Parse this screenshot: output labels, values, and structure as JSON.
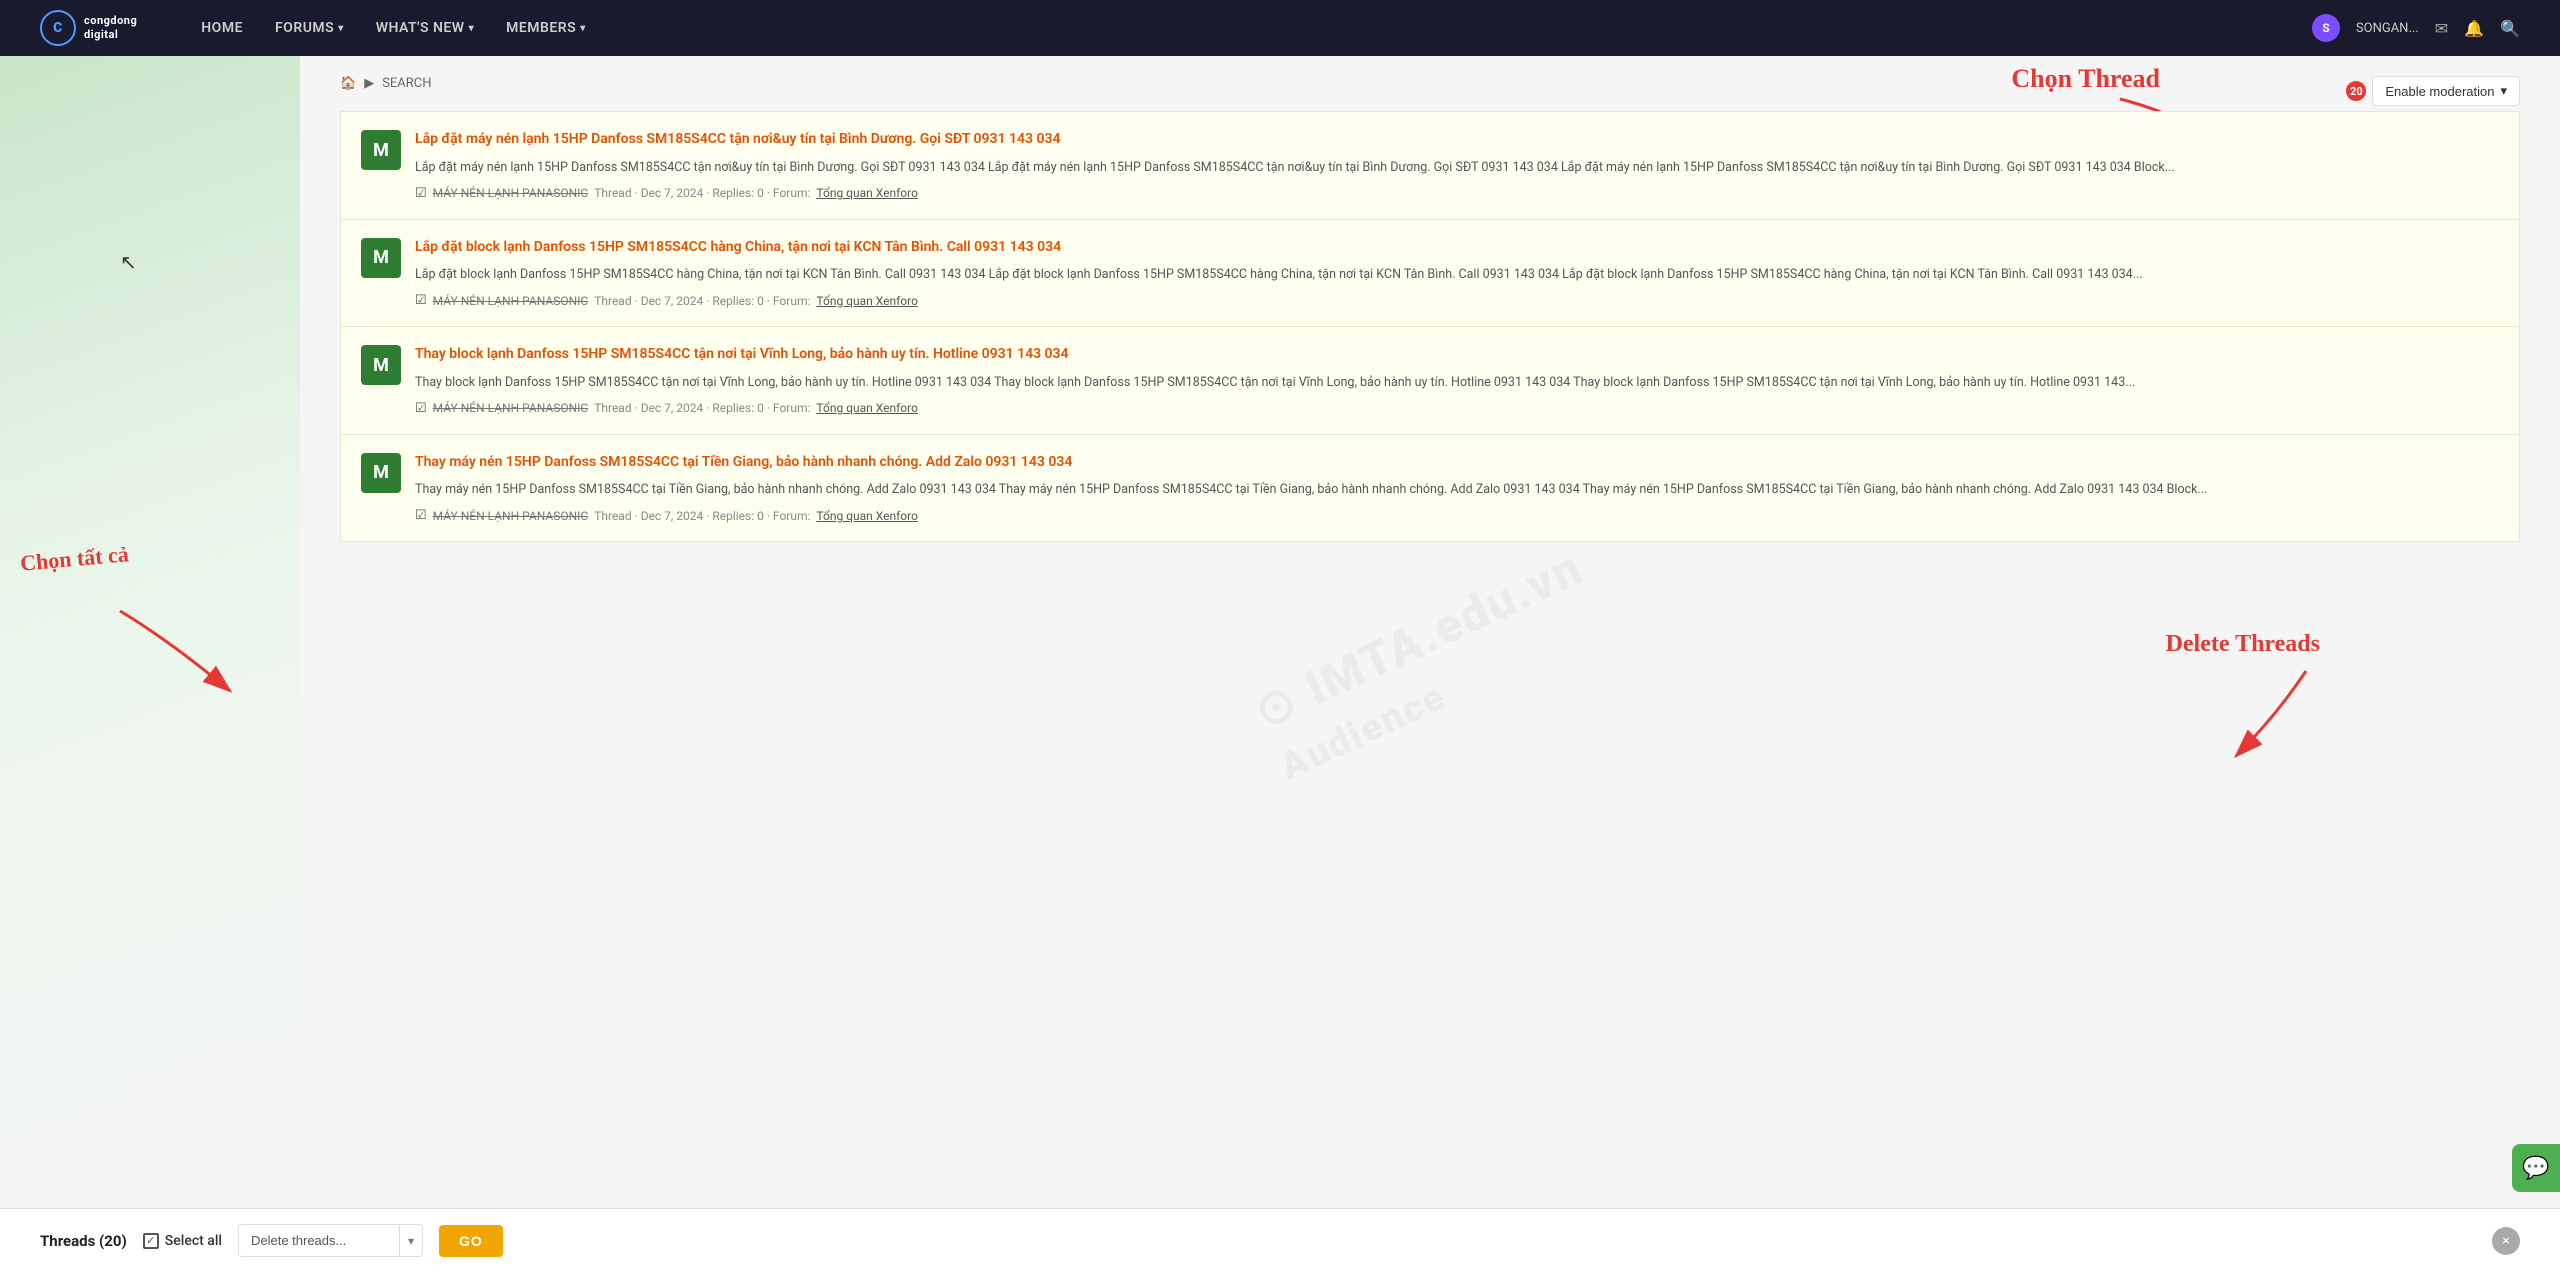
{
  "navbar": {
    "logo_text": "congdong\ndigital",
    "logo_initial": "C",
    "links": [
      {
        "label": "HOME",
        "has_dropdown": false
      },
      {
        "label": "FORUMS",
        "has_dropdown": true
      },
      {
        "label": "WHAT'S NEW",
        "has_dropdown": true
      },
      {
        "label": "MEMBERS",
        "has_dropdown": true
      }
    ],
    "username": "SONGAN...",
    "user_initial": "S"
  },
  "breadcrumb": {
    "home_icon": "🏠",
    "separator": "▶",
    "current": "SEARCH"
  },
  "annotations": {
    "chon_thread": "Chọn Thread",
    "chon_tat_ca": "Chọn tất cả",
    "delete_threads": "Delete Threads"
  },
  "enable_moderation": {
    "badge": "20",
    "label": "Enable moderation",
    "dropdown_arrow": "▾"
  },
  "threads": [
    {
      "avatar": "M",
      "title": "Lắp đặt máy nén lạnh 15HP Danfoss SM185S4CC tận nơi&uy tín tại Bình Dương. Gọi SĐT 0931 143 034",
      "excerpt": "Lắp đặt máy nén lạnh 15HP Danfoss SM185S4CC tận nơi&uy tín tại Bình Dương. Gọi SĐT 0931 143 034 Lắp đặt máy nén lạnh 15HP Danfoss SM185S4CC tận nơi&uy tín tại Bình Dương. Gọi SĐT 0931 143 034 Lắp đặt máy nén lạnh 15HP Danfoss SM185S4CC tận nơi&uy tín tại Bình Dương. Gọi SĐT 0931 143 034 Block...",
      "source": "MÁY NÉN LẠNH PANASONIC",
      "meta": "Thread · Dec 7, 2024 · Replies: 0 · Forum:",
      "forum": "Tổng quan Xenforo"
    },
    {
      "avatar": "M",
      "title": "Lắp đặt block lạnh Danfoss 15HP SM185S4CC hàng China, tận nơi tại KCN Tân Bình. Call 0931 143 034",
      "excerpt": "Lắp đặt block lạnh Danfoss 15HP SM185S4CC hàng China, tận nơi tại KCN Tân Bình. Call 0931 143 034 Lắp đặt block lạnh Danfoss 15HP SM185S4CC hàng China, tận nơi tại KCN Tân Bình. Call 0931 143 034 Lắp đặt block lạnh Danfoss 15HP SM185S4CC hàng China, tận nơi tại KCN Tân Bình. Call 0931 143 034...",
      "source": "MÁY NÉN LẠNH PANASONIC",
      "meta": "Thread · Dec 7, 2024 · Replies: 0 · Forum:",
      "forum": "Tổng quan Xenforo"
    },
    {
      "avatar": "M",
      "title": "Thay block lạnh Danfoss 15HP SM185S4CC tận nơi tại Vĩnh Long, bảo hành uy tín. Hotline 0931 143 034",
      "excerpt": "Thay block lạnh Danfoss 15HP SM185S4CC tận nơi tại Vĩnh Long, bảo hành uy tín. Hotline 0931 143 034 Thay block lạnh Danfoss 15HP SM185S4CC tận nơi tại Vĩnh Long, bảo hành uy tín. Hotline 0931 143 034 Thay block lạnh Danfoss 15HP SM185S4CC tận nơi tại Vĩnh Long, bảo hành uy tín. Hotline 0931 143...",
      "source": "MÁY NÉN LẠNH PANASONIC",
      "meta": "Thread · Dec 7, 2024 · Replies: 0 · Forum:",
      "forum": "Tổng quan Xenforo"
    },
    {
      "avatar": "M",
      "title": "Thay máy nén 15HP Danfoss SM185S4CC tại Tiền Giang, bảo hành nhanh chóng. Add Zalo 0931 143 034",
      "excerpt": "Thay máy nén 15HP Danfoss SM185S4CC tại Tiền Giang, bảo hành nhanh chóng. Add Zalo 0931 143 034 Thay máy nén 15HP Danfoss SM185S4CC tại Tiền Giang, bảo hành nhanh chóng. Add Zalo 0931 143 034 Thay máy nén 15HP Danfoss SM185S4CC tại Tiền Giang, bảo hành nhanh chóng. Add Zalo 0931 143 034 Block...",
      "source": "MÁY NÉN LẠNH PANASONIC",
      "meta": "Thread · Dec 7, 2024 · Replies: 0 · Forum:",
      "forum": "Tổng quan Xenforo"
    }
  ],
  "watermark": {
    "line1": "IMTA.edu.vn",
    "line2": "Audience"
  },
  "bottom_bar": {
    "threads_count": "Threads (20)",
    "select_all": "Select all",
    "delete_option": "Delete threads...",
    "go_label": "GO",
    "close_icon": "×"
  }
}
